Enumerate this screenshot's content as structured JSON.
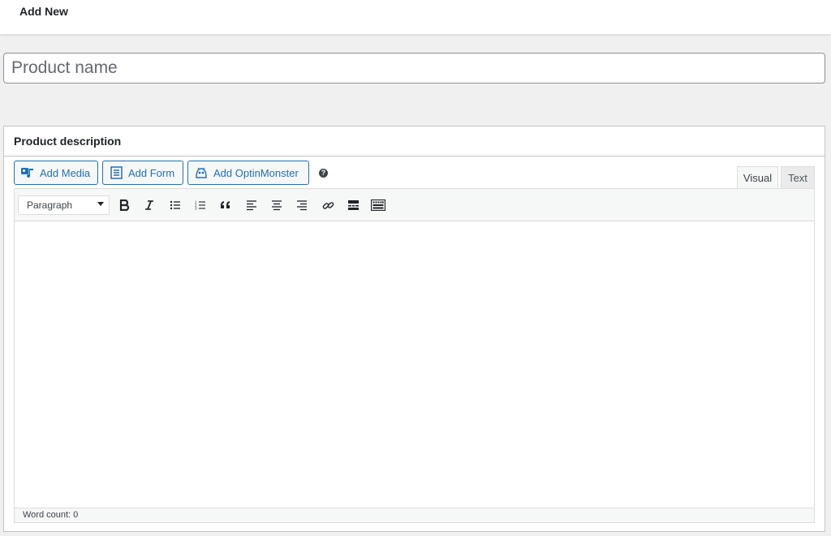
{
  "header": {
    "title": "Add New"
  },
  "product_name": {
    "placeholder": "Product name",
    "value": ""
  },
  "description": {
    "title": "Product description",
    "buttons": {
      "add_media": "Add Media",
      "add_form": "Add Form",
      "add_optinmonster": "Add OptinMonster"
    },
    "tabs": {
      "visual": "Visual",
      "text": "Text"
    },
    "format_select": "Paragraph",
    "toolbar_icons": [
      "bold-icon",
      "italic-icon",
      "bulleted-list-icon",
      "numbered-list-icon",
      "blockquote-icon",
      "align-left-icon",
      "align-center-icon",
      "align-right-icon",
      "link-icon",
      "read-more-icon",
      "toolbar-toggle-icon"
    ],
    "status": "Word count: 0"
  },
  "colors": {
    "accent": "#2271b1",
    "background": "#f0f0f1"
  }
}
